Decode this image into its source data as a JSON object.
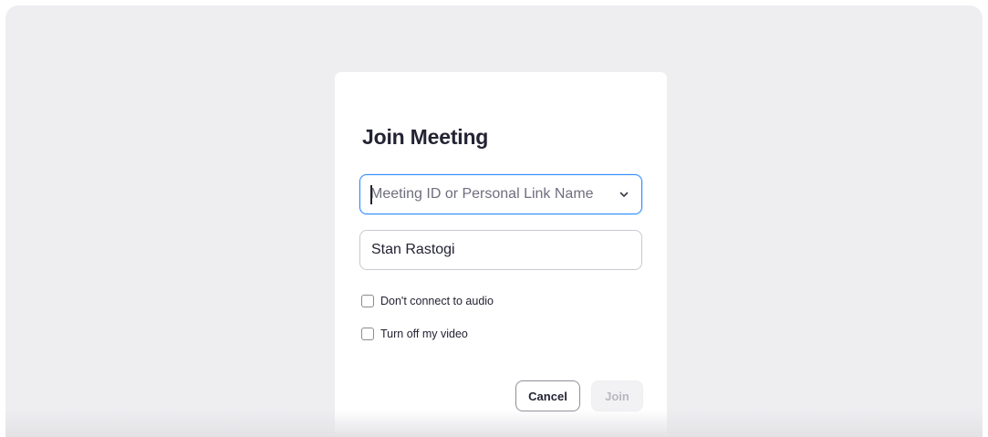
{
  "dialog": {
    "title": "Join Meeting",
    "meeting_field": {
      "placeholder": "Meeting ID or Personal Link Name",
      "value": "",
      "dropdown_icon": "chevron-down-icon"
    },
    "name_field": {
      "value": "Stan Rastogi"
    },
    "options": [
      {
        "label": "Don't connect to audio",
        "checked": false
      },
      {
        "label": "Turn off my video",
        "checked": false
      }
    ],
    "buttons": {
      "cancel_label": "Cancel",
      "join_label": "Join",
      "join_enabled": false
    }
  },
  "colors": {
    "accent": "#2d8cff",
    "background": "#eeeef1",
    "text": "#232333",
    "disabled_text": "#b8b8c0"
  }
}
